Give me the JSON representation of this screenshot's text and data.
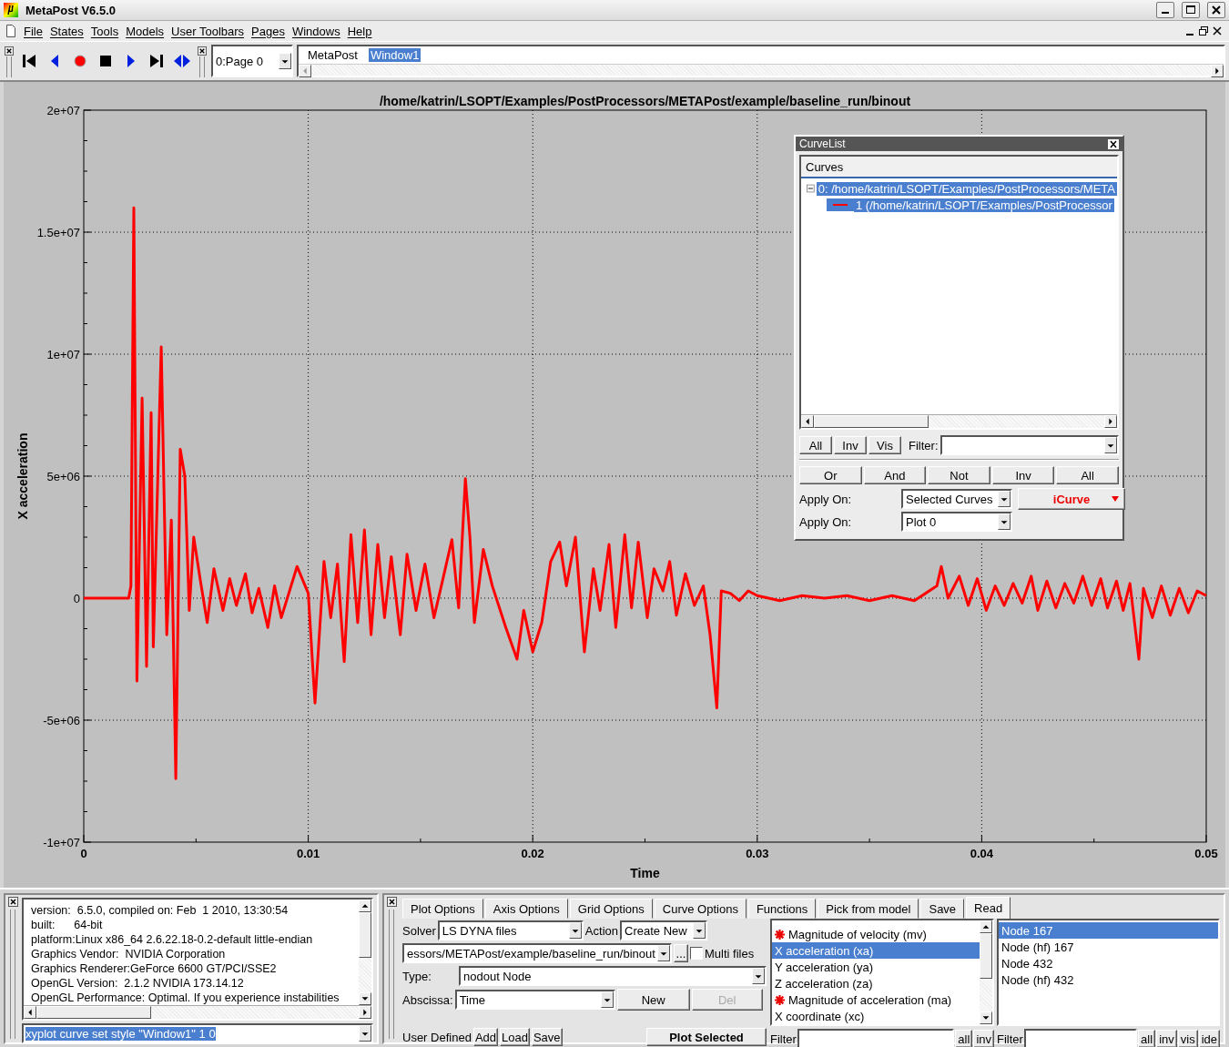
{
  "window": {
    "title": "MetaPost V6.5.0"
  },
  "menu": [
    "File",
    "States",
    "Tools",
    "Models",
    "User Toolbars",
    "Pages",
    "Windows",
    "Help"
  ],
  "toolbar": {
    "page_select": "0:Page 0",
    "window_tabs": [
      {
        "label": "MetaPost",
        "selected": false
      },
      {
        "label": "Window1",
        "selected": true
      }
    ]
  },
  "plot": {
    "chart_data": {
      "type": "line",
      "title": "/home/katrin/LSOPT/Examples/PostProcessors/METAPost/example/baseline_run/binout",
      "xlabel": "Time",
      "ylabel": "X acceleration",
      "xlim": [
        0,
        0.05
      ],
      "ylim": [
        -10000000.0,
        20000000.0
      ],
      "grid": true,
      "xticks": [
        0,
        0.01,
        0.02,
        0.03,
        0.04,
        0.05
      ],
      "yticks": [
        {
          "value": -10000000.0,
          "label": "-1e+07"
        },
        {
          "value": -5000000.0,
          "label": "-5e+06"
        },
        {
          "value": 0,
          "label": "0"
        },
        {
          "value": 5000000.0,
          "label": "5e+06"
        },
        {
          "value": 10000000.0,
          "label": "1e+07"
        },
        {
          "value": 15000000.0,
          "label": "1.5e+07"
        },
        {
          "value": 20000000.0,
          "label": "2e+07"
        }
      ],
      "x": [
        0,
        0.002,
        0.0021,
        0.00223,
        0.00237,
        0.0026,
        0.0028,
        0.003,
        0.0031,
        0.00345,
        0.0037,
        0.0039,
        0.0041,
        0.0043,
        0.0045,
        0.0047,
        0.0049,
        0.0052,
        0.0055,
        0.0058,
        0.0062,
        0.0065,
        0.0068,
        0.0072,
        0.0075,
        0.0078,
        0.0082,
        0.0085,
        0.0088,
        0.0095,
        0.01,
        0.0103,
        0.0107,
        0.011,
        0.0113,
        0.0116,
        0.0119,
        0.0122,
        0.0125,
        0.0128,
        0.0131,
        0.0134,
        0.0137,
        0.0141,
        0.0144,
        0.0148,
        0.0152,
        0.0156,
        0.016,
        0.0164,
        0.0167,
        0.017,
        0.0172,
        0.0174,
        0.0178,
        0.0182,
        0.0188,
        0.0193,
        0.0196,
        0.02,
        0.0204,
        0.0208,
        0.0212,
        0.0215,
        0.0219,
        0.0223,
        0.0227,
        0.023,
        0.0234,
        0.0237,
        0.0241,
        0.0244,
        0.0247,
        0.0251,
        0.0254,
        0.0258,
        0.0261,
        0.0264,
        0.0268,
        0.0272,
        0.0276,
        0.0279,
        0.0282,
        0.0284,
        0.0288,
        0.0292,
        0.0296,
        0.03,
        0.031,
        0.032,
        0.033,
        0.034,
        0.035,
        0.036,
        0.037,
        0.038,
        0.0382,
        0.0385,
        0.039,
        0.0394,
        0.0398,
        0.0402,
        0.0406,
        0.041,
        0.0414,
        0.0418,
        0.0422,
        0.0425,
        0.0429,
        0.0433,
        0.0437,
        0.0441,
        0.0445,
        0.0449,
        0.0453,
        0.0456,
        0.046,
        0.0463,
        0.0466,
        0.047,
        0.0472,
        0.0476,
        0.048,
        0.0484,
        0.0488,
        0.0492,
        0.0496,
        0.05
      ],
      "series": [
        {
          "color": "#ff0000",
          "values": [
            0,
            0,
            500000.0,
            16000000.0,
            -3400000.0,
            8200000.0,
            -2800000.0,
            7600000.0,
            -2000000.0,
            10300000.0,
            -1500000.0,
            3200000.0,
            -7400000.0,
            6100000.0,
            5000000.0,
            -500000.0,
            2500000.0,
            700000.0,
            -1000000.0,
            1200000.0,
            -500000.0,
            800000.0,
            -300000.0,
            1000000.0,
            -600000.0,
            400000.0,
            -1200000.0,
            500000.0,
            -800000.0,
            1300000.0,
            200000.0,
            -4300000.0,
            1500000.0,
            -800000.0,
            1400000.0,
            -2600000.0,
            2600000.0,
            -1000000.0,
            2800000.0,
            -1500000.0,
            2200000.0,
            -800000.0,
            1700000.0,
            -1500000.0,
            1800000.0,
            -500000.0,
            1400000.0,
            -800000.0,
            800000.0,
            2400000.0,
            -400000.0,
            4900000.0,
            2500000.0,
            -1000000.0,
            2000000.0,
            500000.0,
            -1200000.0,
            -2500000.0,
            -500000.0,
            -2200000.0,
            -1000000.0,
            1500000.0,
            2300000.0,
            500000.0,
            2500000.0,
            -2200000.0,
            1200000.0,
            -500000.0,
            2200000.0,
            -1200000.0,
            2600000.0,
            -400000.0,
            2300000.0,
            -800000.0,
            1200000.0,
            300000.0,
            1500000.0,
            -700000.0,
            1000000.0,
            -300000.0,
            500000.0,
            -1500000.0,
            -4500000.0,
            300000.0,
            200000.0,
            -100000.0,
            300000.0,
            100000.0,
            -100000.0,
            100000.0,
            0,
            100000.0,
            -100000.0,
            100000.0,
            -100000.0,
            500000.0,
            1300000.0,
            0,
            900000.0,
            -300000.0,
            800000.0,
            -500000.0,
            500000.0,
            -300000.0,
            600000.0,
            -200000.0,
            900000.0,
            -500000.0,
            700000.0,
            -400000.0,
            600000.0,
            -200000.0,
            900000.0,
            -300000.0,
            800000.0,
            -400000.0,
            700000.0,
            -500000.0,
            600000.0,
            -2500000.0,
            400000.0,
            -800000.0,
            500000.0,
            -700000.0,
            400000.0,
            -600000.0,
            300000.0,
            100000.0
          ]
        }
      ]
    }
  },
  "curve_list": {
    "title": "CurveList",
    "header": "Curves",
    "tree": [
      {
        "label": "0: /home/katrin/LSOPT/Examples/PostProcessors/META",
        "selected": true,
        "expanded": true,
        "children": [
          {
            "label": "1 (/home/katrin/LSOPT/Examples/PostProcessor",
            "selected": true,
            "color": "#ff0000"
          }
        ]
      }
    ],
    "buttons": [
      "All",
      "Inv",
      "Vis"
    ],
    "filter_label": "Filter:",
    "logic_buttons": [
      "Or",
      "And",
      "Not",
      "Inv",
      "All"
    ],
    "apply_rows": [
      {
        "label": "Apply On:",
        "value": "Selected Curves"
      },
      {
        "label": "Apply On:",
        "value": "Plot 0"
      }
    ],
    "icurve_button": "iCurve"
  },
  "console": {
    "lines": [
      "version:  6.5.0, compiled on: Feb  1 2010, 13:30:54",
      "built:      64-bit",
      "platform:Linux x86_64 2.6.22.18-0.2-default little-endian",
      "Graphics Vendor:  NVIDIA Corporation",
      "Graphics Renderer:GeForce 6600 GT/PCI/SSE2",
      "OpenGL Version:  2.1.2 NVIDIA 173.14.12",
      "OpenGL Performance: Optimal. If you experience instabilities"
    ],
    "command": "xyplot curve set style \"Window1\" 1 0"
  },
  "options": {
    "tabs": [
      {
        "label": "Plot Options",
        "selected": false
      },
      {
        "label": "Axis Options",
        "selected": false
      },
      {
        "label": "Grid Options",
        "selected": false
      },
      {
        "label": "Curve Options",
        "selected": false
      },
      {
        "label": "Functions",
        "selected": false
      },
      {
        "label": "Pick from model",
        "selected": false
      },
      {
        "label": "Save",
        "selected": false
      },
      {
        "label": "Read",
        "selected": true
      }
    ],
    "solver_label": "Solver",
    "solver": "LS DYNA files",
    "action_label": "Action",
    "action": "Create New",
    "file_path": "essors/METAPost/example/baseline_run/binout",
    "browse_button": "...",
    "multi_files": {
      "label": "Multi files",
      "checked": false
    },
    "type_label": "Type:",
    "type": "nodout Node",
    "abscissa_label": "Abscissa:",
    "abscissa": "Time",
    "new_button": {
      "label": "New",
      "disabled": false
    },
    "del_button": {
      "label": "Del",
      "disabled": true
    },
    "user_defined_label": "User Defined",
    "user_buttons": [
      "Add",
      "Load",
      "Save"
    ],
    "plot_button": "Plot Selected",
    "components": {
      "items": [
        {
          "label": "Magnitude of velocity (mv)",
          "marked": true,
          "selected": false
        },
        {
          "label": "X acceleration (xa)",
          "marked": false,
          "selected": true
        },
        {
          "label": "Y acceleration (ya)",
          "marked": false,
          "selected": false
        },
        {
          "label": "Z acceleration (za)",
          "marked": false,
          "selected": false
        },
        {
          "label": "Magnitude of acceleration (ma)",
          "marked": true,
          "selected": false
        },
        {
          "label": "X coordinate (xc)",
          "marked": false,
          "selected": false
        }
      ],
      "filter_label": "Filter",
      "buttons": [
        "all",
        "inv"
      ]
    },
    "entities": {
      "items": [
        {
          "label": "Node 167",
          "selected": true
        },
        {
          "label": "Node (hf) 167",
          "selected": false
        },
        {
          "label": "Node 432",
          "selected": false
        },
        {
          "label": "Node (hf) 432",
          "selected": false
        }
      ],
      "filter_label": "Filter",
      "buttons": [
        "all",
        "inv",
        "vis",
        "ide"
      ]
    }
  }
}
